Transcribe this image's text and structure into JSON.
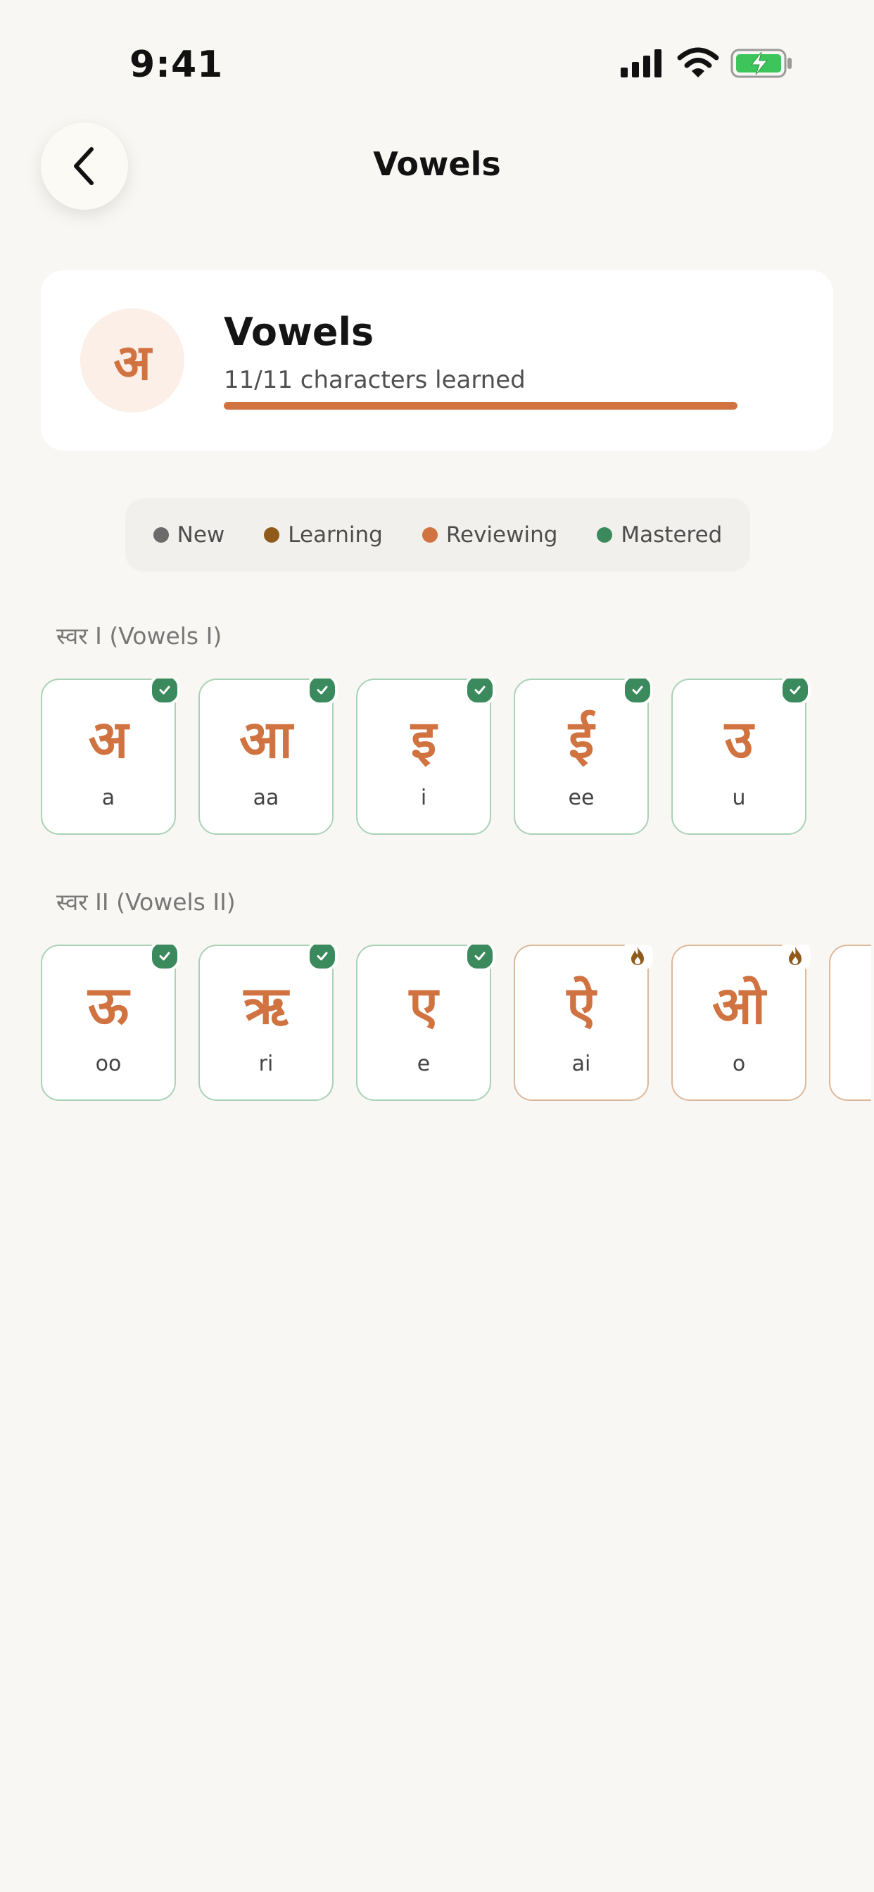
{
  "status": {
    "time": "9:41"
  },
  "header": {
    "title": "Vowels"
  },
  "overview": {
    "glyph": "अ",
    "title": "Vowels",
    "subtitle": "11/11 characters learned",
    "progress": 1.0
  },
  "legend": [
    {
      "label": "New",
      "color": "#6b6b6b"
    },
    {
      "label": "Learning",
      "color": "#8f5a1a"
    },
    {
      "label": "Reviewing",
      "color": "#d07341"
    },
    {
      "label": "Mastered",
      "color": "#3b8a5e"
    }
  ],
  "sections": [
    {
      "label": "स्वर I (Vowels I)",
      "cards": [
        {
          "char": "अ",
          "roman": "a",
          "status": "mastered"
        },
        {
          "char": "आ",
          "roman": "aa",
          "status": "mastered"
        },
        {
          "char": "इ",
          "roman": "i",
          "status": "mastered"
        },
        {
          "char": "ई",
          "roman": "ee",
          "status": "mastered"
        },
        {
          "char": "उ",
          "roman": "u",
          "status": "mastered"
        }
      ]
    },
    {
      "label": "स्वर II (Vowels II)",
      "cards": [
        {
          "char": "ऊ",
          "roman": "oo",
          "status": "mastered"
        },
        {
          "char": "ऋ",
          "roman": "ri",
          "status": "mastered"
        },
        {
          "char": "ए",
          "roman": "e",
          "status": "mastered"
        },
        {
          "char": "ऐ",
          "roman": "ai",
          "status": "reviewing"
        },
        {
          "char": "ओ",
          "roman": "o",
          "status": "reviewing"
        }
      ]
    }
  ],
  "icons": {
    "back": "chevron-left-icon",
    "mastered": "check-icon",
    "reviewing": "flame-icon"
  }
}
